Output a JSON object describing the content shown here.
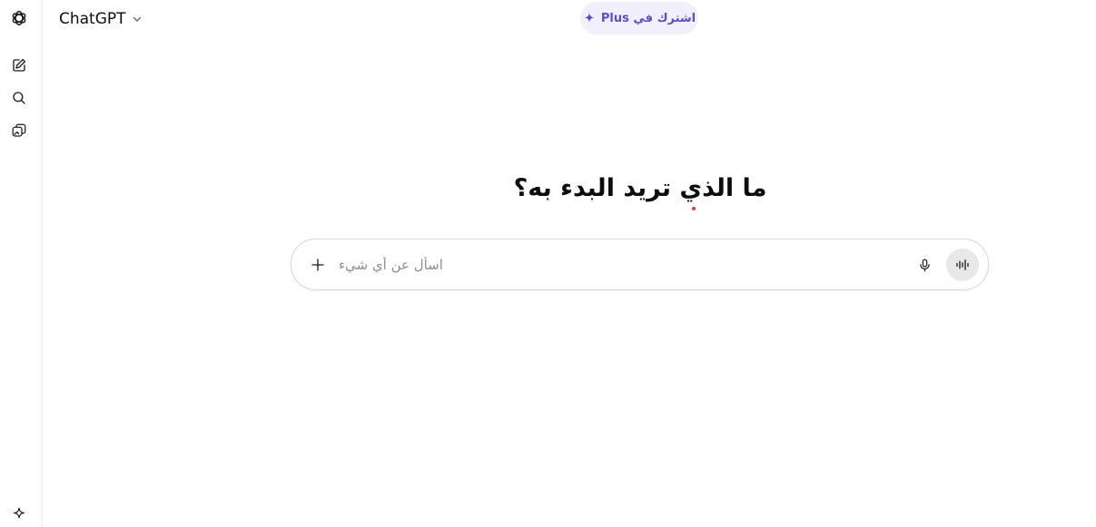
{
  "header": {
    "model_name": "ChatGPT",
    "upgrade_label": "اشترك في Plus"
  },
  "main": {
    "headline": "ما الذي تريد البدء به؟"
  },
  "composer": {
    "placeholder": "اسأل عن أي شيء",
    "value": ""
  },
  "icons": {
    "logo": "openai-logo-icon",
    "new_chat": "new-chat-icon",
    "search": "search-icon",
    "library": "library-icon",
    "upgrade": "sparkle-icon",
    "chevron": "chevron-down-icon",
    "attach": "plus-icon",
    "mic": "microphone-icon",
    "voice": "voice-mode-icon"
  },
  "colors": {
    "accent": "#5b4ec7",
    "pill_background": "#f1effc",
    "voice_button_background": "#e8e8e8",
    "spellcheck_dot": "#e5383b"
  }
}
